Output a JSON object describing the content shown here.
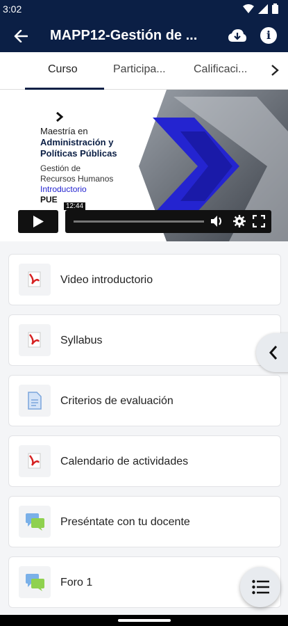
{
  "status": {
    "time": "3:02"
  },
  "appbar": {
    "title": "MAPP12-Gestión de ..."
  },
  "tabs": [
    {
      "label": "Curso"
    },
    {
      "label": "Participa..."
    },
    {
      "label": "Calificaci..."
    }
  ],
  "video": {
    "line1": "Maestría en",
    "line2": "Administración y",
    "line3": "Políticas Públicas",
    "line4": "Gestión de",
    "line5": "Recursos Humanos",
    "line6": "Introductorio",
    "line7": "PUE",
    "time_tip": "12:44"
  },
  "items": [
    {
      "label": "Video introductorio",
      "icon": "pdf-icon"
    },
    {
      "label": "Syllabus",
      "icon": "pdf-icon"
    },
    {
      "label": "Criterios de evaluación",
      "icon": "file-icon"
    },
    {
      "label": "Calendario de actividades",
      "icon": "pdf-icon"
    },
    {
      "label": "Preséntate con tu docente",
      "icon": "forum-icon"
    },
    {
      "label": "Foro 1",
      "icon": "forum-icon"
    }
  ],
  "colors": {
    "brand": "#0b1f45",
    "accent_blue": "#2424d0",
    "pdf_red": "#d62222"
  }
}
